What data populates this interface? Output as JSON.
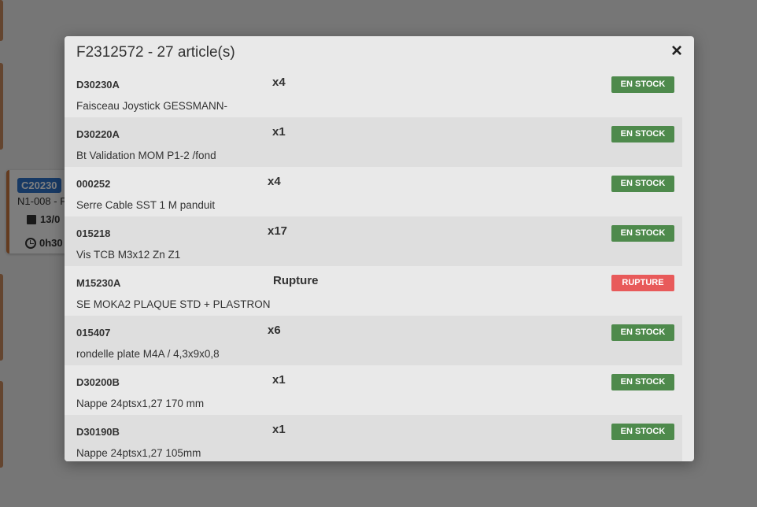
{
  "background": {
    "card": {
      "badge": "C20230",
      "subtitle": "N1-008 - F",
      "date": "13/0",
      "duration": "0h30"
    }
  },
  "modal": {
    "title": "F2312572 - 27 article(s)",
    "close_label": "×",
    "items": [
      {
        "code": "D30230A",
        "qty": "x4",
        "description": "Faisceau Joystick GESSMANN-",
        "status": "EN STOCK",
        "status_type": "stock"
      },
      {
        "code": "D30220A",
        "qty": "x1",
        "description": "Bt Validation MOM P1-2 /fond",
        "status": "EN STOCK",
        "status_type": "stock"
      },
      {
        "code": "000252",
        "qty": "x4",
        "description": "Serre Cable SST 1 M panduit",
        "status": "EN STOCK",
        "status_type": "stock"
      },
      {
        "code": "015218",
        "qty": "x17",
        "description": "Vis TCB M3x12 Zn Z1",
        "status": "EN STOCK",
        "status_type": "stock"
      },
      {
        "code": "M15230A",
        "qty": "Rupture",
        "description": "SE MOKA2 PLAQUE STD + PLASTRON",
        "status": "RUPTURE",
        "status_type": "rupture"
      },
      {
        "code": "015407",
        "qty": "x6",
        "description": "rondelle plate M4A / 4,3x9x0,8",
        "status": "EN STOCK",
        "status_type": "stock"
      },
      {
        "code": "D30200B",
        "qty": "x1",
        "description": "Nappe 24ptsx1,27 170 mm",
        "status": "EN STOCK",
        "status_type": "stock"
      },
      {
        "code": "D30190B",
        "qty": "x1",
        "description": "Nappe 24ptsx1,27 105mm",
        "status": "EN STOCK",
        "status_type": "stock"
      }
    ]
  },
  "colors": {
    "stock": "#4e8a4c",
    "rupture": "#e85a5a",
    "overlay": "rgba(0,0,0,0.5)"
  }
}
